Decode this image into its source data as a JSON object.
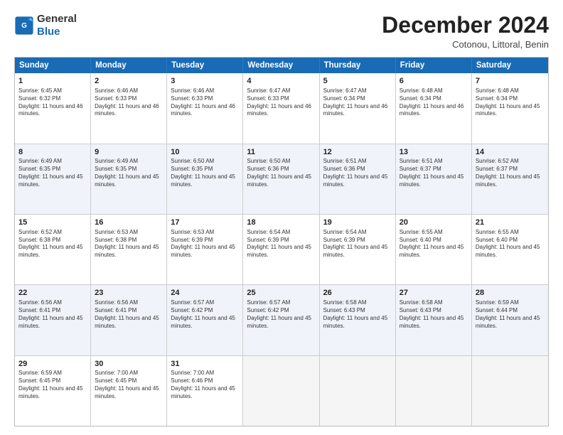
{
  "logo": {
    "line1": "General",
    "line2": "Blue"
  },
  "title": "December 2024",
  "subtitle": "Cotonou, Littoral, Benin",
  "headers": [
    "Sunday",
    "Monday",
    "Tuesday",
    "Wednesday",
    "Thursday",
    "Friday",
    "Saturday"
  ],
  "weeks": [
    {
      "alt": false,
      "days": [
        {
          "date": "1",
          "sunrise": "6:45 AM",
          "sunset": "6:32 PM",
          "daylight": "11 hours and 46 minutes."
        },
        {
          "date": "2",
          "sunrise": "6:46 AM",
          "sunset": "6:33 PM",
          "daylight": "11 hours and 46 minutes."
        },
        {
          "date": "3",
          "sunrise": "6:46 AM",
          "sunset": "6:33 PM",
          "daylight": "11 hours and 46 minutes."
        },
        {
          "date": "4",
          "sunrise": "6:47 AM",
          "sunset": "6:33 PM",
          "daylight": "11 hours and 46 minutes."
        },
        {
          "date": "5",
          "sunrise": "6:47 AM",
          "sunset": "6:34 PM",
          "daylight": "11 hours and 46 minutes."
        },
        {
          "date": "6",
          "sunrise": "6:48 AM",
          "sunset": "6:34 PM",
          "daylight": "11 hours and 46 minutes."
        },
        {
          "date": "7",
          "sunrise": "6:48 AM",
          "sunset": "6:34 PM",
          "daylight": "11 hours and 45 minutes."
        }
      ]
    },
    {
      "alt": true,
      "days": [
        {
          "date": "8",
          "sunrise": "6:49 AM",
          "sunset": "6:35 PM",
          "daylight": "11 hours and 45 minutes."
        },
        {
          "date": "9",
          "sunrise": "6:49 AM",
          "sunset": "6:35 PM",
          "daylight": "11 hours and 45 minutes."
        },
        {
          "date": "10",
          "sunrise": "6:50 AM",
          "sunset": "6:35 PM",
          "daylight": "11 hours and 45 minutes."
        },
        {
          "date": "11",
          "sunrise": "6:50 AM",
          "sunset": "6:36 PM",
          "daylight": "11 hours and 45 minutes."
        },
        {
          "date": "12",
          "sunrise": "6:51 AM",
          "sunset": "6:36 PM",
          "daylight": "11 hours and 45 minutes."
        },
        {
          "date": "13",
          "sunrise": "6:51 AM",
          "sunset": "6:37 PM",
          "daylight": "11 hours and 45 minutes."
        },
        {
          "date": "14",
          "sunrise": "6:52 AM",
          "sunset": "6:37 PM",
          "daylight": "11 hours and 45 minutes."
        }
      ]
    },
    {
      "alt": false,
      "days": [
        {
          "date": "15",
          "sunrise": "6:52 AM",
          "sunset": "6:38 PM",
          "daylight": "11 hours and 45 minutes."
        },
        {
          "date": "16",
          "sunrise": "6:53 AM",
          "sunset": "6:38 PM",
          "daylight": "11 hours and 45 minutes."
        },
        {
          "date": "17",
          "sunrise": "6:53 AM",
          "sunset": "6:39 PM",
          "daylight": "11 hours and 45 minutes."
        },
        {
          "date": "18",
          "sunrise": "6:54 AM",
          "sunset": "6:39 PM",
          "daylight": "11 hours and 45 minutes."
        },
        {
          "date": "19",
          "sunrise": "6:54 AM",
          "sunset": "6:39 PM",
          "daylight": "11 hours and 45 minutes."
        },
        {
          "date": "20",
          "sunrise": "6:55 AM",
          "sunset": "6:40 PM",
          "daylight": "11 hours and 45 minutes."
        },
        {
          "date": "21",
          "sunrise": "6:55 AM",
          "sunset": "6:40 PM",
          "daylight": "11 hours and 45 minutes."
        }
      ]
    },
    {
      "alt": true,
      "days": [
        {
          "date": "22",
          "sunrise": "6:56 AM",
          "sunset": "6:41 PM",
          "daylight": "11 hours and 45 minutes."
        },
        {
          "date": "23",
          "sunrise": "6:56 AM",
          "sunset": "6:41 PM",
          "daylight": "11 hours and 45 minutes."
        },
        {
          "date": "24",
          "sunrise": "6:57 AM",
          "sunset": "6:42 PM",
          "daylight": "11 hours and 45 minutes."
        },
        {
          "date": "25",
          "sunrise": "6:57 AM",
          "sunset": "6:42 PM",
          "daylight": "11 hours and 45 minutes."
        },
        {
          "date": "26",
          "sunrise": "6:58 AM",
          "sunset": "6:43 PM",
          "daylight": "11 hours and 45 minutes."
        },
        {
          "date": "27",
          "sunrise": "6:58 AM",
          "sunset": "6:43 PM",
          "daylight": "11 hours and 45 minutes."
        },
        {
          "date": "28",
          "sunrise": "6:59 AM",
          "sunset": "6:44 PM",
          "daylight": "11 hours and 45 minutes."
        }
      ]
    },
    {
      "alt": false,
      "days": [
        {
          "date": "29",
          "sunrise": "6:59 AM",
          "sunset": "6:45 PM",
          "daylight": "11 hours and 45 minutes."
        },
        {
          "date": "30",
          "sunrise": "7:00 AM",
          "sunset": "6:45 PM",
          "daylight": "11 hours and 45 minutes."
        },
        {
          "date": "31",
          "sunrise": "7:00 AM",
          "sunset": "6:46 PM",
          "daylight": "11 hours and 45 minutes."
        },
        {
          "date": "",
          "sunrise": "",
          "sunset": "",
          "daylight": ""
        },
        {
          "date": "",
          "sunrise": "",
          "sunset": "",
          "daylight": ""
        },
        {
          "date": "",
          "sunrise": "",
          "sunset": "",
          "daylight": ""
        },
        {
          "date": "",
          "sunrise": "",
          "sunset": "",
          "daylight": ""
        }
      ]
    }
  ]
}
